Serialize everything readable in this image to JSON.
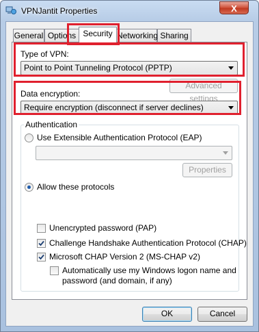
{
  "window": {
    "title": "VPNJantit Properties",
    "close_glyph": "X"
  },
  "tabs": [
    {
      "label": "General"
    },
    {
      "label": "Options"
    },
    {
      "label": "Security"
    },
    {
      "label": "Networking"
    },
    {
      "label": "Sharing"
    }
  ],
  "vpn_type": {
    "label": "Type of VPN:",
    "selected": "Point to Point Tunneling Protocol (PPTP)"
  },
  "advanced_settings_label": "Advanced settings",
  "data_encryption": {
    "label": "Data encryption:",
    "selected": "Require encryption (disconnect if server declines)"
  },
  "authentication": {
    "title": "Authentication",
    "eap_label": "Use Extensible Authentication Protocol (EAP)",
    "eap_selected": "",
    "eap_properties_label": "Properties",
    "allow_label": "Allow these protocols",
    "protocols": [
      {
        "label": "Unencrypted password (PAP)",
        "checked": false
      },
      {
        "label": "Challenge Handshake Authentication Protocol (CHAP)",
        "checked": true
      },
      {
        "label": "Microsoft CHAP Version 2 (MS-CHAP v2)",
        "checked": true
      }
    ],
    "auto_logon": {
      "label_line1": "Automatically use my Windows logon name and",
      "label_line2": "password (and domain, if any)",
      "checked": false
    }
  },
  "buttons": {
    "ok": "OK",
    "cancel": "Cancel"
  },
  "colors": {
    "highlight": "#e0202e",
    "selection_accent": "#1d5aab"
  }
}
